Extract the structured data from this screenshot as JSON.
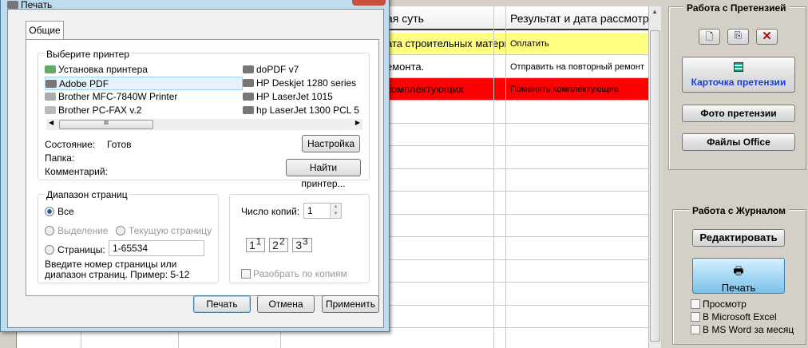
{
  "grid": {
    "headers": [
      "ая суть",
      "Результат и дата рассмотрен"
    ],
    "rows": [
      {
        "col1": "ата строительных матери",
        "col2": "Оплатить",
        "color": "#ffff80"
      },
      {
        "col1": "емонта.",
        "col2": "Отправить на повторный ремонт",
        "color": "#ffffff"
      },
      {
        "col1": "комплектующих",
        "col2": "Поменять комплектующие",
        "color": "#ff0000"
      }
    ]
  },
  "claim_panel": {
    "title": "Работа с Претензией",
    "card_button": "Карточка претензии",
    "photo_button": "Фото претензии",
    "files_button": "Файлы Office"
  },
  "journal_panel": {
    "title": "Работа с Журналом",
    "edit_button": "Редактировать",
    "print_button": "Печать",
    "checkboxes": [
      "Просмотр",
      "В Microsoft Excel",
      "В MS Word за месяц"
    ]
  },
  "dialog": {
    "title": "Печать",
    "tab": "Общие",
    "printer_group": "Выберите принтер",
    "printers_left": [
      "Установка принтера",
      "Adobe PDF",
      "Brother MFC-7840W Printer",
      "Brother PC-FAX v.2"
    ],
    "printers_right": [
      "doPDF v7",
      "HP Deskjet 1280 series",
      "HP LaserJet 1015",
      "hp LaserJet 1300 PCL 5"
    ],
    "selected_printer": "Adobe PDF",
    "status_label": "Состояние:",
    "status_value": "Готов",
    "folder_label": "Папка:",
    "comment_label": "Комментарий:",
    "settings_button": "Настройка",
    "find_button": "Найти принтер...",
    "range_group": "Диапазон страниц",
    "range_all": "Все",
    "range_selection": "Выделение",
    "range_current": "Текущую страницу",
    "range_pages": "Страницы:",
    "pages_value": "1-65534",
    "range_hint": "Введите номер страницы или диапазон страниц.  Пример: 5-12",
    "copies_label": "Число копий:",
    "copies_value": "1",
    "collate_label": "Разобрать по копиям",
    "print_button": "Печать",
    "cancel_button": "Отмена",
    "apply_button": "Применить"
  }
}
